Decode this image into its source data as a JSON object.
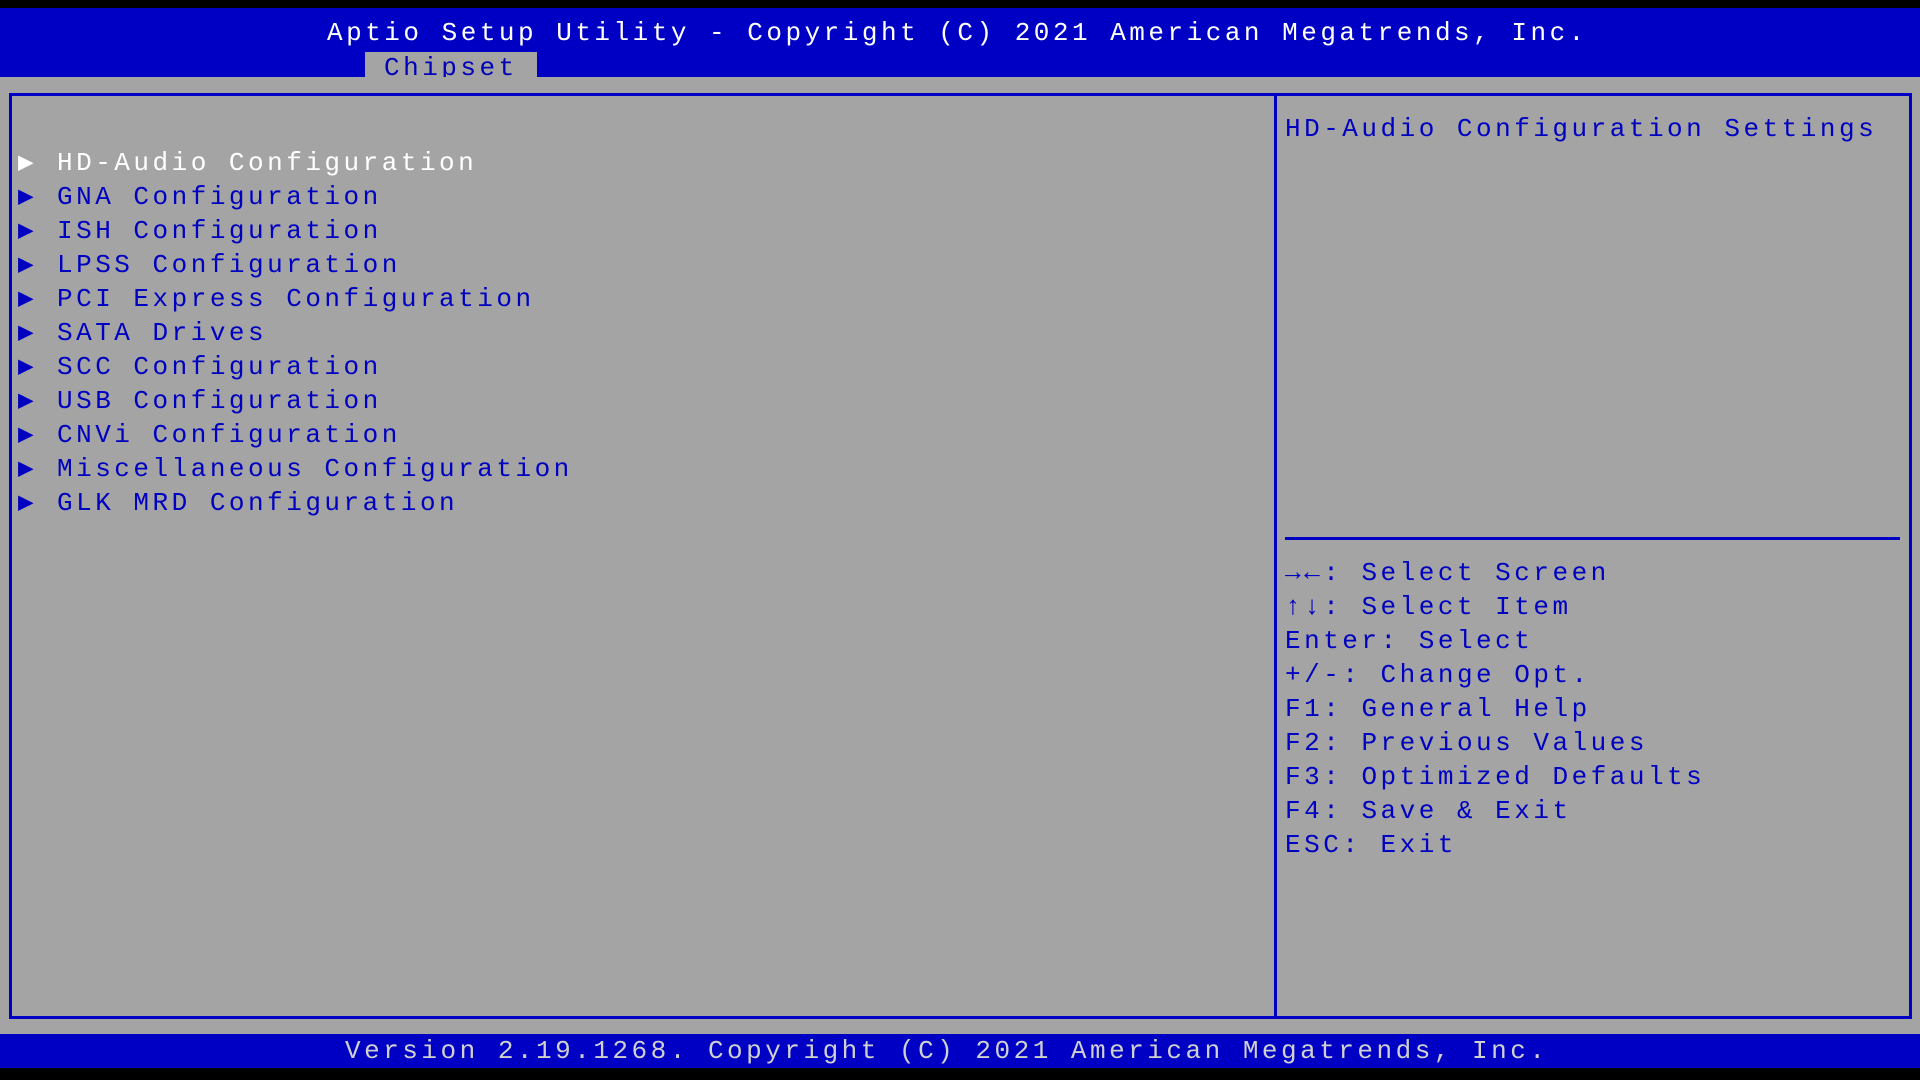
{
  "header": {
    "title": "Aptio Setup Utility - Copyright (C) 2021 American Megatrends, Inc.",
    "active_tab": "Chipset"
  },
  "menu": {
    "arrow_icon": "▶",
    "selected_index": 0,
    "items": [
      {
        "label": "HD-Audio Configuration"
      },
      {
        "label": "GNA Configuration"
      },
      {
        "label": "ISH Configuration"
      },
      {
        "label": "LPSS Configuration"
      },
      {
        "label": "PCI Express Configuration"
      },
      {
        "label": "SATA Drives"
      },
      {
        "label": "SCC Configuration"
      },
      {
        "label": "USB Configuration"
      },
      {
        "label": "CNVi Configuration"
      },
      {
        "label": "Miscellaneous Configuration"
      },
      {
        "label": "GLK MRD Configuration"
      }
    ]
  },
  "help": {
    "description": "HD-Audio Configuration Settings",
    "keys": [
      {
        "key": "→←",
        "action": "Select Screen"
      },
      {
        "key": "↑↓",
        "action": "Select Item"
      },
      {
        "key": "Enter",
        "action": "Select"
      },
      {
        "key": "+/-",
        "action": "Change Opt."
      },
      {
        "key": "F1",
        "action": "General Help"
      },
      {
        "key": "F2",
        "action": "Previous Values"
      },
      {
        "key": "F3",
        "action": "Optimized Defaults"
      },
      {
        "key": "F4",
        "action": "Save & Exit"
      },
      {
        "key": "ESC",
        "action": "Exit"
      }
    ]
  },
  "footer": {
    "version": "Version 2.19.1268. Copyright (C) 2021 American Megatrends, Inc."
  },
  "colors": {
    "blue": "#0000c4",
    "gray": "#a4a4a4",
    "text_blue": "#0000c0",
    "text_selected": "#ffffff"
  }
}
